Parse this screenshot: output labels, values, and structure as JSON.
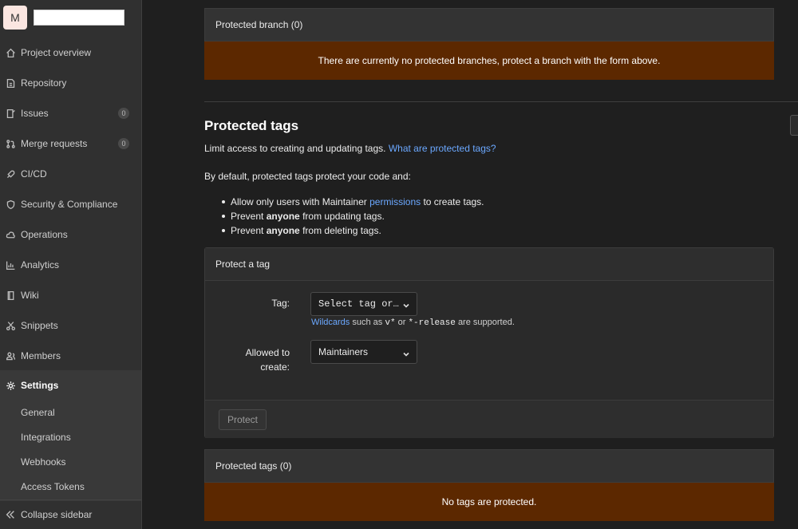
{
  "sidebar": {
    "avatar_letter": "M",
    "items": [
      {
        "label": "Project overview",
        "icon": "home-icon"
      },
      {
        "label": "Repository",
        "icon": "doc-icon"
      },
      {
        "label": "Issues",
        "icon": "issues-icon",
        "badge": "0"
      },
      {
        "label": "Merge requests",
        "icon": "merge-icon",
        "badge": "0"
      },
      {
        "label": "CI/CD",
        "icon": "rocket-icon"
      },
      {
        "label": "Security & Compliance",
        "icon": "shield-icon"
      },
      {
        "label": "Operations",
        "icon": "cloud-icon"
      },
      {
        "label": "Analytics",
        "icon": "chart-icon"
      },
      {
        "label": "Wiki",
        "icon": "book-icon"
      },
      {
        "label": "Snippets",
        "icon": "scissors-icon"
      },
      {
        "label": "Members",
        "icon": "users-icon"
      },
      {
        "label": "Settings",
        "icon": "gear-icon"
      }
    ],
    "settings_sub": [
      "General",
      "Integrations",
      "Webhooks",
      "Access Tokens"
    ],
    "collapse_label": "Collapse sidebar"
  },
  "branches": {
    "header": "Protected branch (0)",
    "empty": "There are currently no protected branches, protect a branch with the form above."
  },
  "tags": {
    "title": "Protected tags",
    "intro": "Limit access to creating and updating tags.",
    "intro_link": "What are protected tags?",
    "default_text": "By default, protected tags protect your code and:",
    "bullet1_pre": "Allow only users with Maintainer",
    "bullet1_link": "permissions",
    "bullet1_post": "to create tags.",
    "bullet2_pre": "Prevent",
    "bullet2_bold": "anyone",
    "bullet2_post": "from updating tags.",
    "bullet3_pre": "Prevent",
    "bullet3_bold": "anyone",
    "bullet3_post": "from deleting tags.",
    "form": {
      "header": "Protect a tag",
      "tag_label": "Tag:",
      "tag_value": "Select tag or…",
      "hint_link": "Wildcards",
      "hint_mid1": "such as",
      "hint_code1": "v*",
      "hint_mid2": "or",
      "hint_code2": "*-release",
      "hint_post": "are supported.",
      "allowed_label_1": "Allowed to",
      "allowed_label_2": "create:",
      "allowed_value": "Maintainers",
      "protect_button": "Protect"
    },
    "list_header": "Protected tags (0)",
    "list_empty": "No tags are protected."
  }
}
